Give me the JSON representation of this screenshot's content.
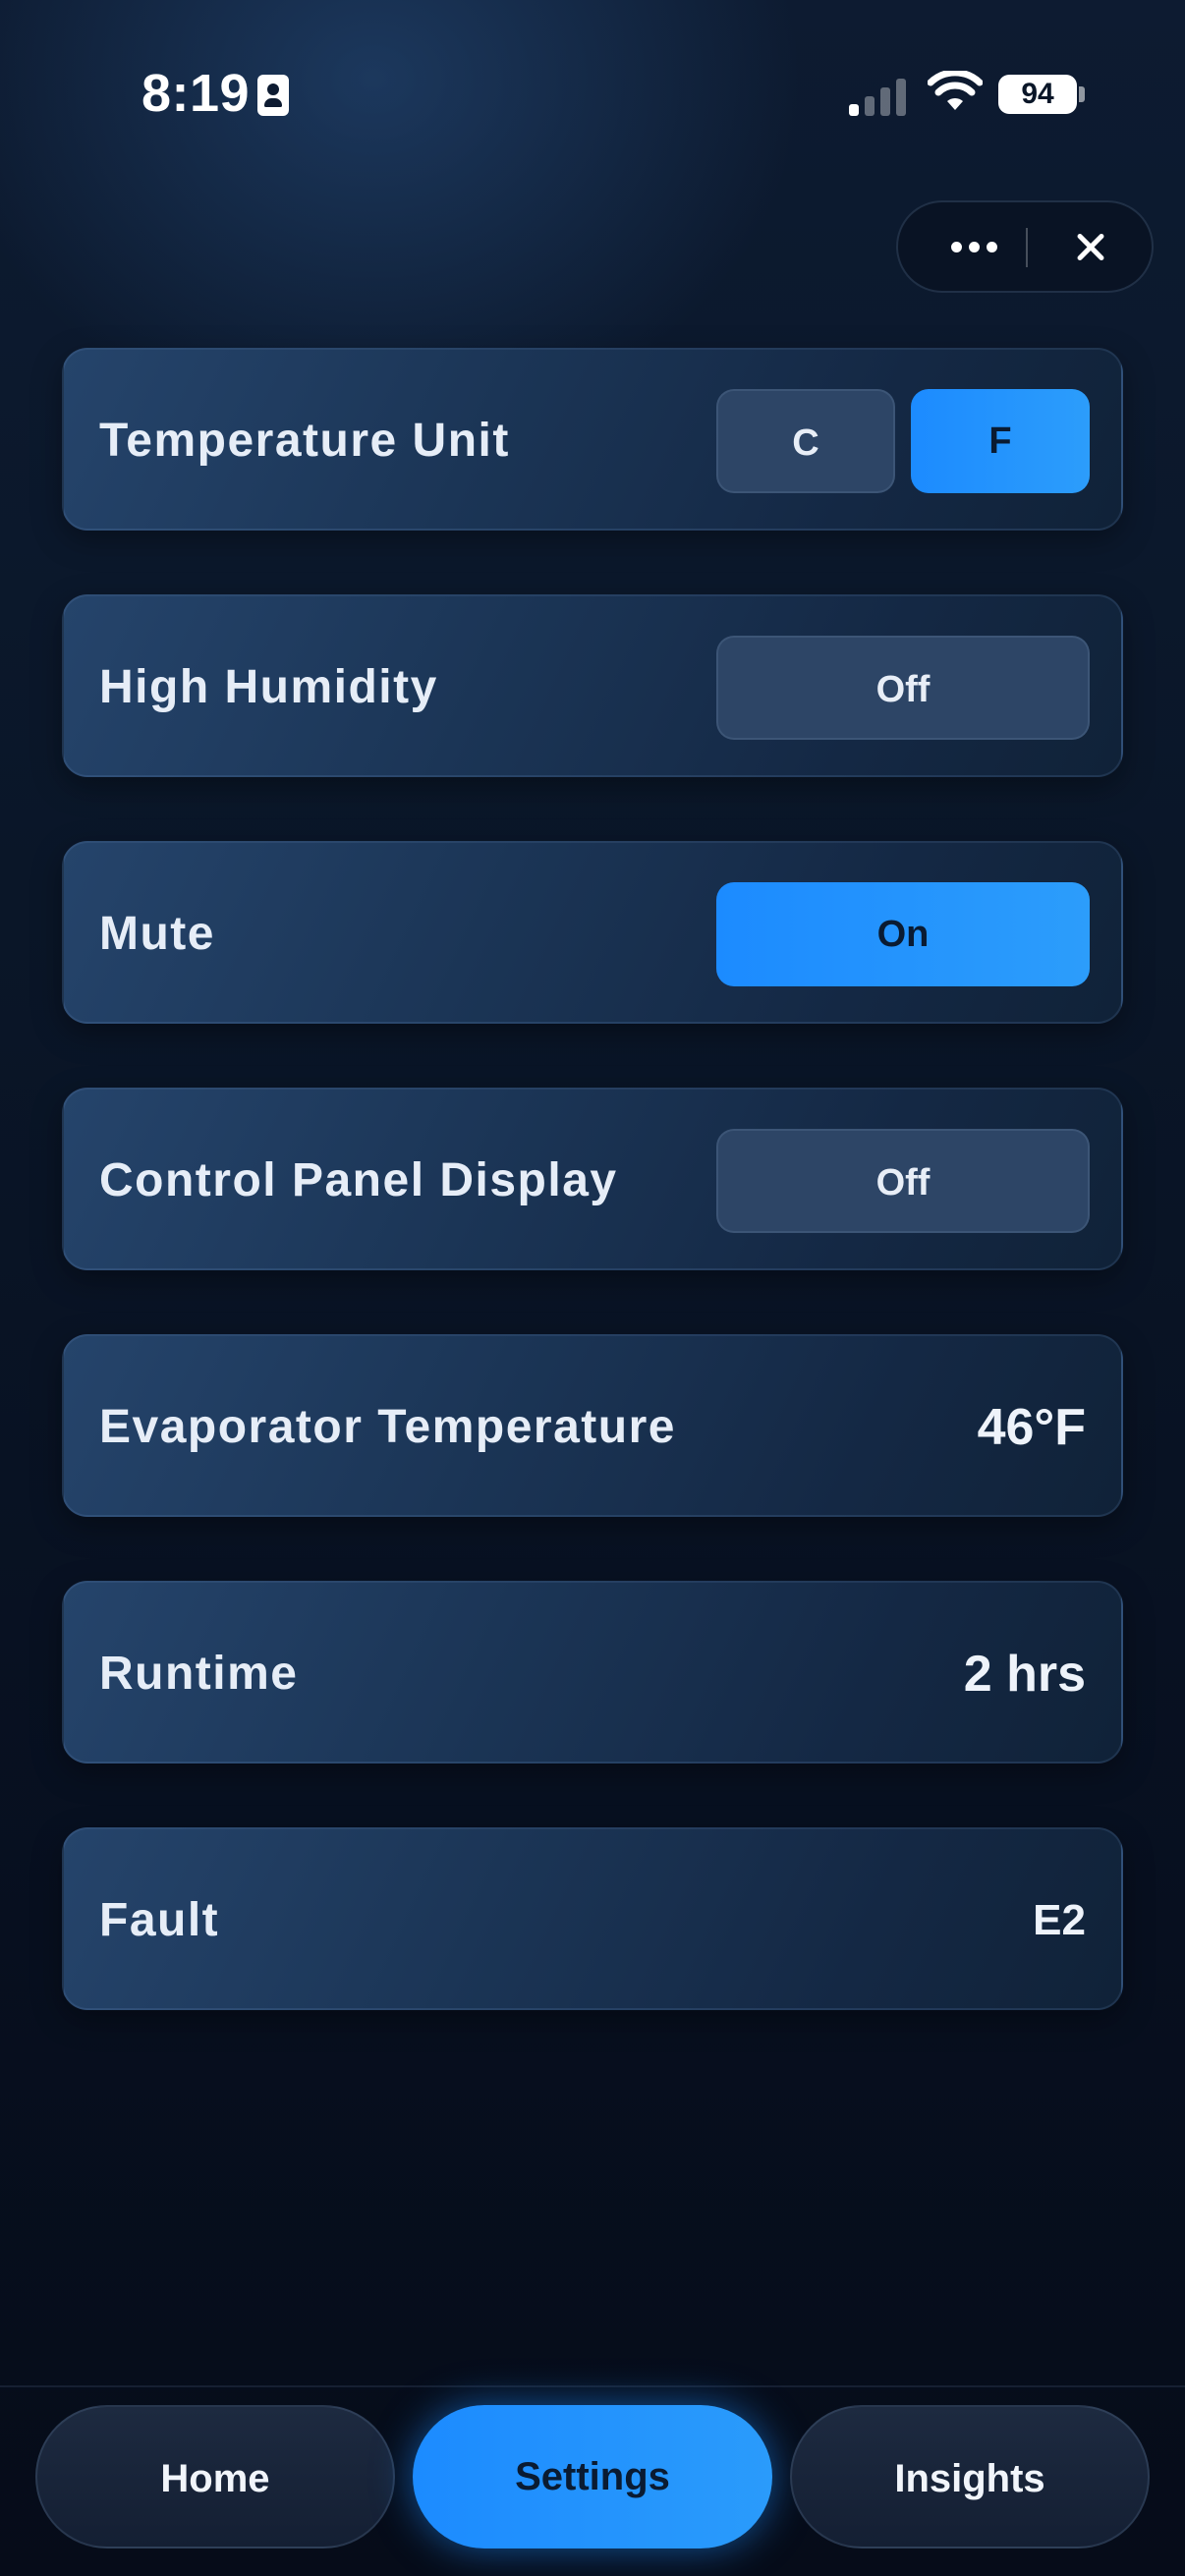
{
  "status_bar": {
    "time": "8:19",
    "battery": "94",
    "signal_icon": "cellular-signal-icon",
    "wifi_icon": "wifi-icon"
  },
  "capsule": {
    "more_icon": "more-dots-icon",
    "close_icon": "close-icon"
  },
  "settings": {
    "temperature_unit": {
      "label": "Temperature Unit",
      "options": [
        "C",
        "F"
      ],
      "selected": "F"
    },
    "high_humidity": {
      "label": "High Humidity",
      "value": "Off"
    },
    "mute": {
      "label": "Mute",
      "value": "On"
    },
    "control_panel_display": {
      "label": "Control Panel Display",
      "value": "Off"
    },
    "evaporator_temperature": {
      "label": "Evaporator Temperature",
      "value": "46°F"
    },
    "runtime": {
      "label": "Runtime",
      "value": "2 hrs"
    },
    "fault": {
      "label": "Fault",
      "value": "E2"
    }
  },
  "nav": {
    "items": [
      {
        "label": "Home",
        "active": false
      },
      {
        "label": "Settings",
        "active": true
      },
      {
        "label": "Insights",
        "active": false
      }
    ]
  },
  "colors": {
    "accent": "#1c8bff",
    "background": "#0a1628",
    "card": "#1b3556",
    "button_off": "#2d4566"
  }
}
